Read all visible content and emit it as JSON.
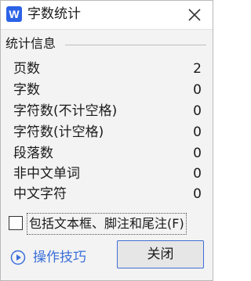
{
  "window": {
    "app_icon_letter": "W",
    "title": "字数统计"
  },
  "section": {
    "title": "统计信息"
  },
  "stats": [
    {
      "label": "页数",
      "value": "2"
    },
    {
      "label": "字数",
      "value": "0"
    },
    {
      "label": "字符数(不计空格)",
      "value": "0"
    },
    {
      "label": "字符数(计空格)",
      "value": "0"
    },
    {
      "label": "段落数",
      "value": "0"
    },
    {
      "label": "非中文单词",
      "value": "0"
    },
    {
      "label": "中文字符",
      "value": "0"
    }
  ],
  "option": {
    "label": "包括文本框、脚注和尾注(F)",
    "checked": false
  },
  "footer": {
    "tips_label": "操作技巧",
    "close_label": "关闭"
  },
  "colors": {
    "accent": "#2b62e6",
    "link": "#3a6fd8",
    "button_border": "#3f6fd7"
  }
}
